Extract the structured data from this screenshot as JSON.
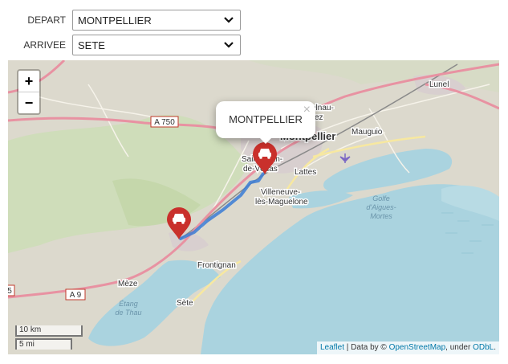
{
  "form": {
    "depart_label": "DEPART",
    "depart_value": "MONTPELLIER",
    "arrivee_label": "ARRIVEE",
    "arrivee_value": "SETE"
  },
  "map": {
    "zoom_in": "+",
    "zoom_out": "−",
    "popup": {
      "text": "MONTPELLIER",
      "close": "×"
    },
    "scale": {
      "metric": "10 km",
      "imperial": "5 mi"
    },
    "attribution": {
      "leaflet": "Leaflet",
      "separator": " | Data by © ",
      "osm": "OpenStreetMap",
      "under": ", under ",
      "license": "ODbL",
      "end": "."
    },
    "place_labels": {
      "lunel": "Lunel",
      "mauguio": "Mauguio",
      "montpellier": "Montpellier",
      "castelnau_1": "elnau-",
      "castelnau_2": "ez",
      "st_jean_1": "Saint-Jean-",
      "st_jean_2": "de-Védas",
      "lattes": "Lattes",
      "villeneuve_1": "Villeneuve-",
      "villeneuve_2": "lès-Maguelone",
      "golfe_1": "Golfe",
      "golfe_2": "d'Aigues-",
      "golfe_3": "Mortes",
      "frontignan": "Frontignan",
      "meze": "Mèze",
      "sete": "Sète",
      "etang_1": "Étang",
      "etang_2": "de Thau",
      "a750": "A 750",
      "a9": "A 9",
      "edge5": "5"
    },
    "colors": {
      "land": "#dcd9cd",
      "sea": "#aad3df",
      "forest": "#c8dcb0",
      "motorway": "#e892a2",
      "route": "#3a7bd5",
      "marker": "#c9302c"
    }
  }
}
